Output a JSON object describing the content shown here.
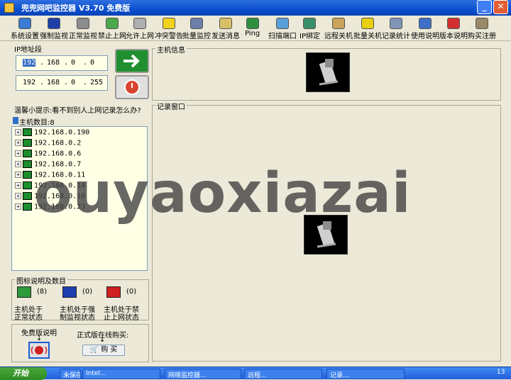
{
  "window": {
    "title": "兜兜网吧监控器 V3.70 免费版"
  },
  "toolbar": {
    "items": [
      {
        "label": "系统设置",
        "icon": "settings-icon",
        "color": "#3A7BD5"
      },
      {
        "label": "强制监视",
        "icon": "monitor-icon",
        "color": "#1F3FA8"
      },
      {
        "label": "正常监视",
        "icon": "monitor-grey-icon",
        "color": "#8C8C8C"
      },
      {
        "label": "禁止上网",
        "icon": "block-icon",
        "color": "#4BA84B"
      },
      {
        "label": "允许上网",
        "icon": "allow-icon",
        "color": "#AFAFAF"
      },
      {
        "label": "冲突警告",
        "icon": "warning-icon",
        "color": "#F2D21B"
      },
      {
        "label": "批量监控",
        "icon": "batch-monitor-icon",
        "color": "#6D7FA8"
      },
      {
        "label": "发送消息",
        "icon": "message-icon",
        "color": "#D8C068"
      },
      {
        "label": "Ping",
        "icon": "globe-icon",
        "color": "#2F8F3F"
      },
      {
        "label": "扫描端口",
        "icon": "scan-icon",
        "color": "#5AA0D8"
      },
      {
        "label": "IP绑定",
        "icon": "ip-bind-icon",
        "color": "#3A8F6B"
      },
      {
        "label": "远程关机",
        "icon": "remote-shutdown-icon",
        "color": "#C9A45A"
      },
      {
        "label": "批量关机",
        "icon": "radiation-icon",
        "color": "#E8D010"
      },
      {
        "label": "记录统计",
        "icon": "stats-icon",
        "color": "#7F95B5"
      },
      {
        "label": "使用说明",
        "icon": "help-icon",
        "color": "#3E6FC8"
      },
      {
        "label": "版本说明",
        "icon": "version-icon",
        "color": "#D23030"
      },
      {
        "label": "购买注册",
        "icon": "key-icon",
        "color": "#9A8A6A"
      }
    ]
  },
  "ip_section": {
    "title": "IP地址段",
    "start_ip": [
      "192",
      ".",
      "168",
      ".",
      "0",
      ".",
      "0"
    ],
    "end_ip": [
      "192",
      ".",
      "168",
      ".",
      "0",
      ".",
      "255"
    ],
    "go_button_color": "#1F8F2F",
    "stop_button_color": "#D84430"
  },
  "tip": {
    "text": "温馨小提示:看不到别人上网记录怎么办?"
  },
  "host_tree": {
    "header": "主机数目:8",
    "hosts": [
      "192.168.0.190",
      "192.168.0.2",
      "192.168.0.6",
      "192.168.0.7",
      "192.168.0.11",
      "192.168.0.14",
      "192.168.0.16",
      "192.168.0.23"
    ]
  },
  "legend": {
    "title": "图标说明及数目",
    "items": [
      {
        "count": "(8)",
        "line1": "主机处于",
        "line2": "正常状态",
        "color": "#2E9A3A"
      },
      {
        "count": "(0)",
        "line1": "主机处于强",
        "line2": "制监视状态",
        "color": "#1F3FB0"
      },
      {
        "count": "(0)",
        "line1": "主机处于禁",
        "line2": "止上网状态",
        "color": "#D02020"
      }
    ]
  },
  "bottom": {
    "free_label": "免费版说明",
    "buy_label": "正式版在线购买:",
    "buy_button": "购 买"
  },
  "host_info": {
    "title": "主机信息"
  },
  "record_window": {
    "title": "记录窗口"
  },
  "watermark": {
    "text": "ouyaoxiazai"
  },
  "taskbar": {
    "start": "开始",
    "items": [
      "未保存",
      "Intel...",
      "网络监控器...",
      "远程...",
      "记录..."
    ],
    "clock": "13"
  }
}
